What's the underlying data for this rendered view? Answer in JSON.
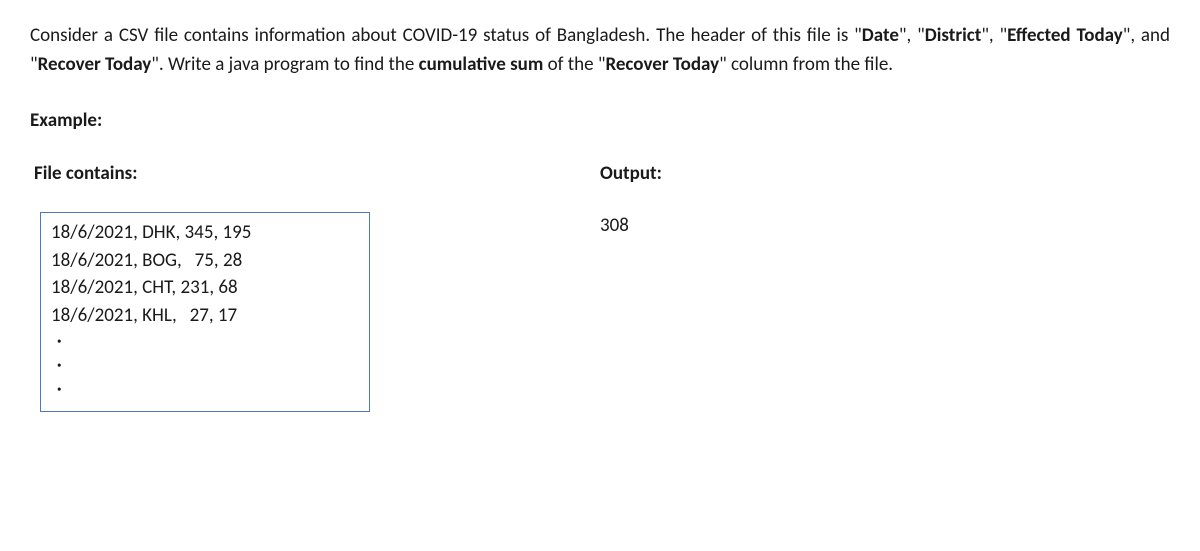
{
  "intro": {
    "part1": "Consider a CSV file contains information about COVID-19 status of Bangladesh. The header of this file is \"",
    "bold1": "Date",
    "part2": "\", \"",
    "bold2": "District",
    "part3": "\", \"",
    "bold3": "Effected Today",
    "part4": "\", and \"",
    "bold4": "Recover Today",
    "part5": "\". Write a java program to find the ",
    "bold5": "cumulative sum",
    "part6": " of the \"",
    "bold6": "Recover Today",
    "part7": "\" column from the file."
  },
  "example_label": "Example:",
  "file_contains_label": "File contains:",
  "output_label": "Output:",
  "file_rows": {
    "r1": "18/6/2021, DHK, 345, 195",
    "r2": "18/6/2021, BOG,   75, 28",
    "r3": "18/6/2021, CHT, 231, 68",
    "r4": "18/6/2021, KHL,   27, 17"
  },
  "output_value": "308"
}
